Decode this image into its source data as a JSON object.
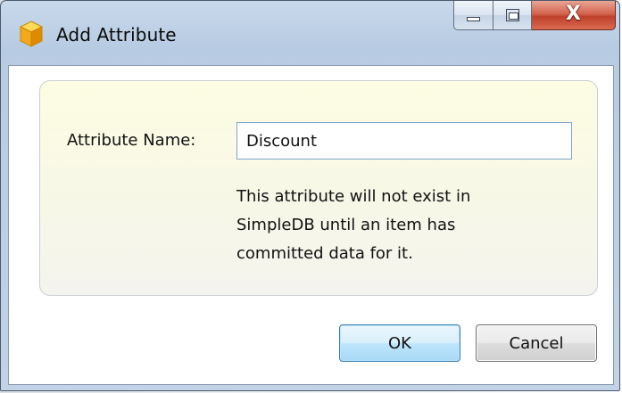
{
  "window": {
    "title": "Add Attribute",
    "close_glyph": "X",
    "app_icon": "yellow-cube-icon"
  },
  "form": {
    "attribute_name_label": "Attribute Name:",
    "attribute_name_value": "Discount",
    "hint": "This attribute will not exist in SimpleDB until an item has committed data for it."
  },
  "buttons": {
    "ok_label": "OK",
    "cancel_label": "Cancel"
  },
  "colors": {
    "panel_background": "#f8f8e6",
    "ok_button_accent": "#bee6fd",
    "close_button": "#c0412b"
  }
}
